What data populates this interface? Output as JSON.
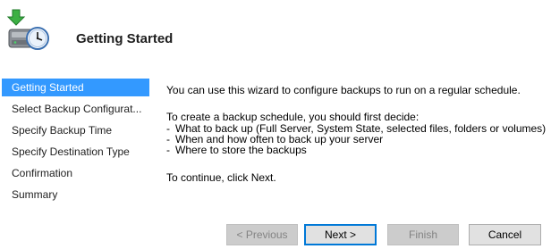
{
  "header": {
    "title": "Getting Started",
    "icon": "backup-schedule-icon"
  },
  "nav": {
    "items": [
      {
        "label": "Getting Started",
        "selected": true
      },
      {
        "label": "Select Backup Configurat...",
        "selected": false
      },
      {
        "label": "Specify Backup Time",
        "selected": false
      },
      {
        "label": "Specify Destination Type",
        "selected": false
      },
      {
        "label": "Confirmation",
        "selected": false
      },
      {
        "label": "Summary",
        "selected": false
      }
    ],
    "selected_color": "#3399ff"
  },
  "content": {
    "intro": "You can use this wizard to configure backups to run on a regular schedule.",
    "lead": "To create a backup schedule, you should first decide:",
    "bullets": [
      "What to back up (Full Server, System State, selected files, folders or volumes)",
      "When and how often to back up your server",
      "Where to store the backups"
    ],
    "bullet_marker": "-",
    "continue": "To continue, click Next."
  },
  "buttons": {
    "previous": "< Previous",
    "next": "Next >",
    "finish": "Finish",
    "cancel": "Cancel"
  }
}
